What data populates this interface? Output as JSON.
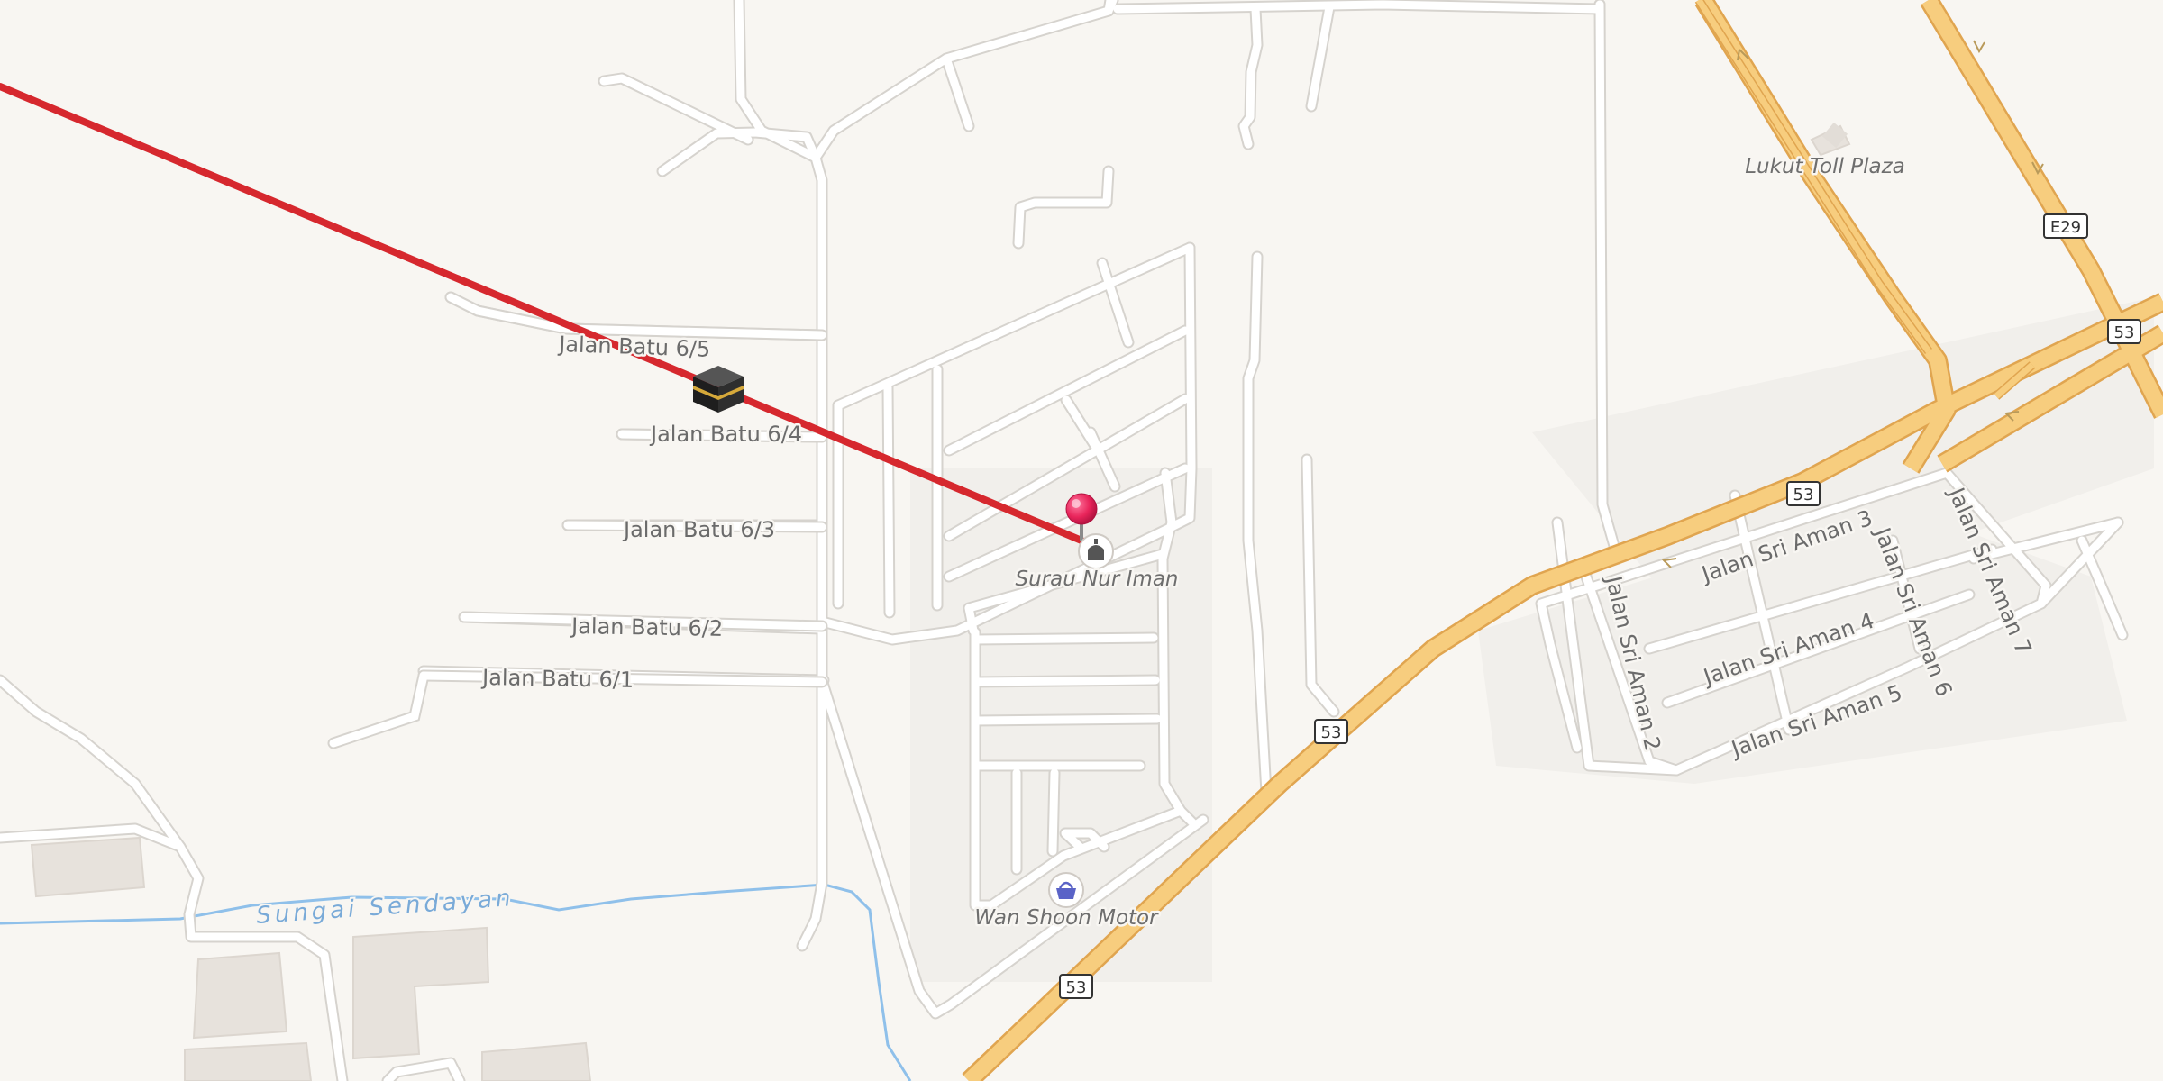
{
  "map": {
    "streets": [
      {
        "id": "jalan-batu-6-5",
        "label": "Jalan Batu 6/5"
      },
      {
        "id": "jalan-batu-6-4",
        "label": "Jalan Batu 6/4"
      },
      {
        "id": "jalan-batu-6-3",
        "label": "Jalan Batu 6/3"
      },
      {
        "id": "jalan-batu-6-2",
        "label": "Jalan Batu 6/2"
      },
      {
        "id": "jalan-batu-6-1",
        "label": "Jalan Batu 6/1"
      },
      {
        "id": "jalan-sri-aman-2",
        "label": "Jalan Sri Aman 2"
      },
      {
        "id": "jalan-sri-aman-3",
        "label": "Jalan Sri Aman 3"
      },
      {
        "id": "jalan-sri-aman-4",
        "label": "Jalan Sri Aman 4"
      },
      {
        "id": "jalan-sri-aman-5",
        "label": "Jalan Sri Aman 5"
      },
      {
        "id": "jalan-sri-aman-6",
        "label": "Jalan Sri Aman 6"
      },
      {
        "id": "jalan-sri-aman-7",
        "label": "Jalan Sri Aman 7"
      }
    ],
    "pois": [
      {
        "id": "surau",
        "label": "Surau Nur Iman",
        "icon": "mosque-icon"
      },
      {
        "id": "wan-shoon",
        "label": "Wan Shoon Motor",
        "icon": "shopping-basket-icon"
      },
      {
        "id": "toll",
        "label": "Lukut Toll Plaza",
        "icon": "toll-plaza-icon"
      }
    ],
    "water": {
      "label": "Sungai Sendayan"
    },
    "route_shields": {
      "r53": "53",
      "e29": "E29"
    },
    "qibla_marker": {
      "icon": "kaaba-icon"
    },
    "location_pin": {
      "icon": "pin-icon"
    },
    "colors": {
      "background": "#f8f6f2",
      "minor_road": "#ffffff",
      "highway": "#f6c877",
      "qibla_line": "#d6282e",
      "pin": "#e8245a",
      "water": "#8fc0ea"
    }
  }
}
